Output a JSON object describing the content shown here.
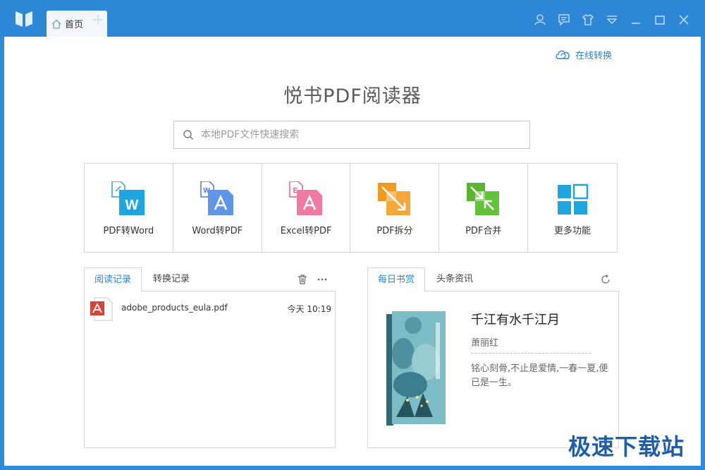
{
  "window": {
    "tab_label": "首页",
    "new_tab_symbol": "+",
    "controls": [
      "user-icon",
      "feedback-icon",
      "skin-icon",
      "menu-icon",
      "minimize-icon",
      "maximize-icon",
      "close-icon"
    ]
  },
  "colors": {
    "titlebar": "#2d87d6",
    "accent": "#2a84cf"
  },
  "header": {
    "online_convert": "在线转换",
    "app_title": "悦书PDF阅读器"
  },
  "search": {
    "placeholder": "本地PDF文件快速搜索"
  },
  "features": [
    {
      "label": "PDF转Word",
      "icon": "pdf-to-word-icon"
    },
    {
      "label": "Word转PDF",
      "icon": "word-to-pdf-icon"
    },
    {
      "label": "Excel转PDF",
      "icon": "excel-to-pdf-icon"
    },
    {
      "label": "PDF拆分",
      "icon": "pdf-split-icon"
    },
    {
      "label": "PDF合并",
      "icon": "pdf-merge-icon"
    },
    {
      "label": "更多功能",
      "icon": "more-features-icon"
    }
  ],
  "left_panel": {
    "tabs": [
      "阅读记录",
      "转换记录"
    ],
    "files": [
      {
        "name": "adobe_products_eula.pdf",
        "time": "今天 10:19"
      }
    ]
  },
  "right_panel": {
    "tabs": [
      "每日书赏",
      "头条资讯"
    ],
    "book": {
      "title": "千江有水千江月",
      "author": "萧丽红",
      "quote": "铭心刻骨,不止是爱情,一春一夏,便已是一生。"
    }
  },
  "watermark": "极速下载站"
}
